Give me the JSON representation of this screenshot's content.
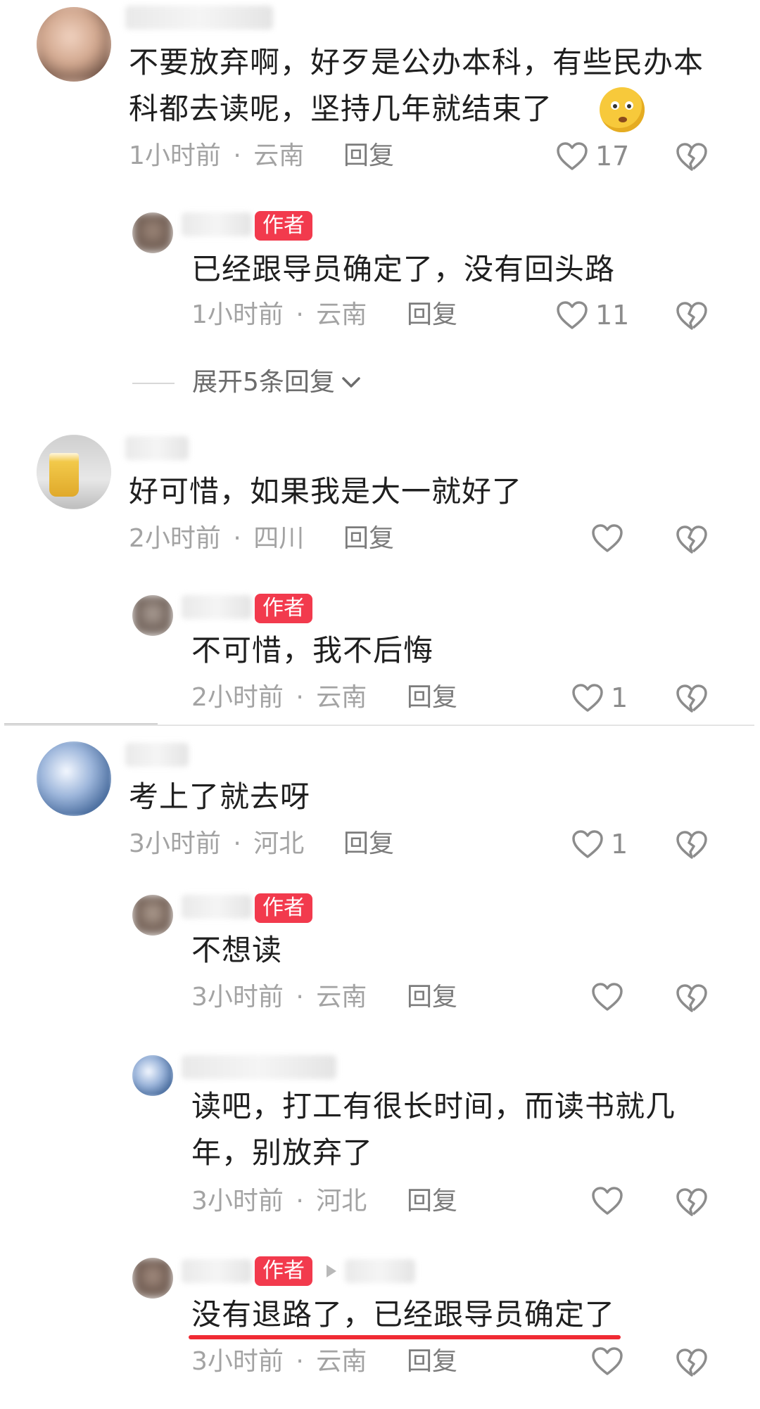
{
  "colors": {
    "badge": "#f23a4d",
    "meta": "#a3a3a3",
    "underline": "#f02a33"
  },
  "comments": [
    {
      "text": "不要放弃啊，好歹是公办本科，有些民办本科都去读呢，坚持几年就结束了",
      "time": "1小时前",
      "location": "云南",
      "reply_label": "回复",
      "likes": "17",
      "emoji": "thinking-face-emoji"
    },
    {
      "badge": "作者",
      "text": "已经跟导员确定了，没有回头路",
      "time": "1小时前",
      "location": "云南",
      "reply_label": "回复",
      "likes": "11"
    },
    {
      "expand_label": "展开5条回复"
    },
    {
      "text": "好可惜，如果我是大一就好了",
      "time": "2小时前",
      "location": "四川",
      "reply_label": "回复",
      "likes": ""
    },
    {
      "badge": "作者",
      "text": "不可惜，我不后悔",
      "time": "2小时前",
      "location": "云南",
      "reply_label": "回复",
      "likes": "1"
    },
    {
      "text": "考上了就去呀",
      "time": "3小时前",
      "location": "河北",
      "reply_label": "回复",
      "likes": "1"
    },
    {
      "badge": "作者",
      "text": "不想读",
      "time": "3小时前",
      "location": "云南",
      "reply_label": "回复",
      "likes": ""
    },
    {
      "text": "读吧，打工有很长时间，而读书就几年，别放弃了",
      "time": "3小时前",
      "location": "河北",
      "reply_label": "回复",
      "likes": ""
    },
    {
      "badge": "作者",
      "text": "没有退路了，已经跟导员确定了",
      "time": "3小时前",
      "location": "云南",
      "reply_label": "回复",
      "likes": ""
    }
  ],
  "meta_separator": "·"
}
